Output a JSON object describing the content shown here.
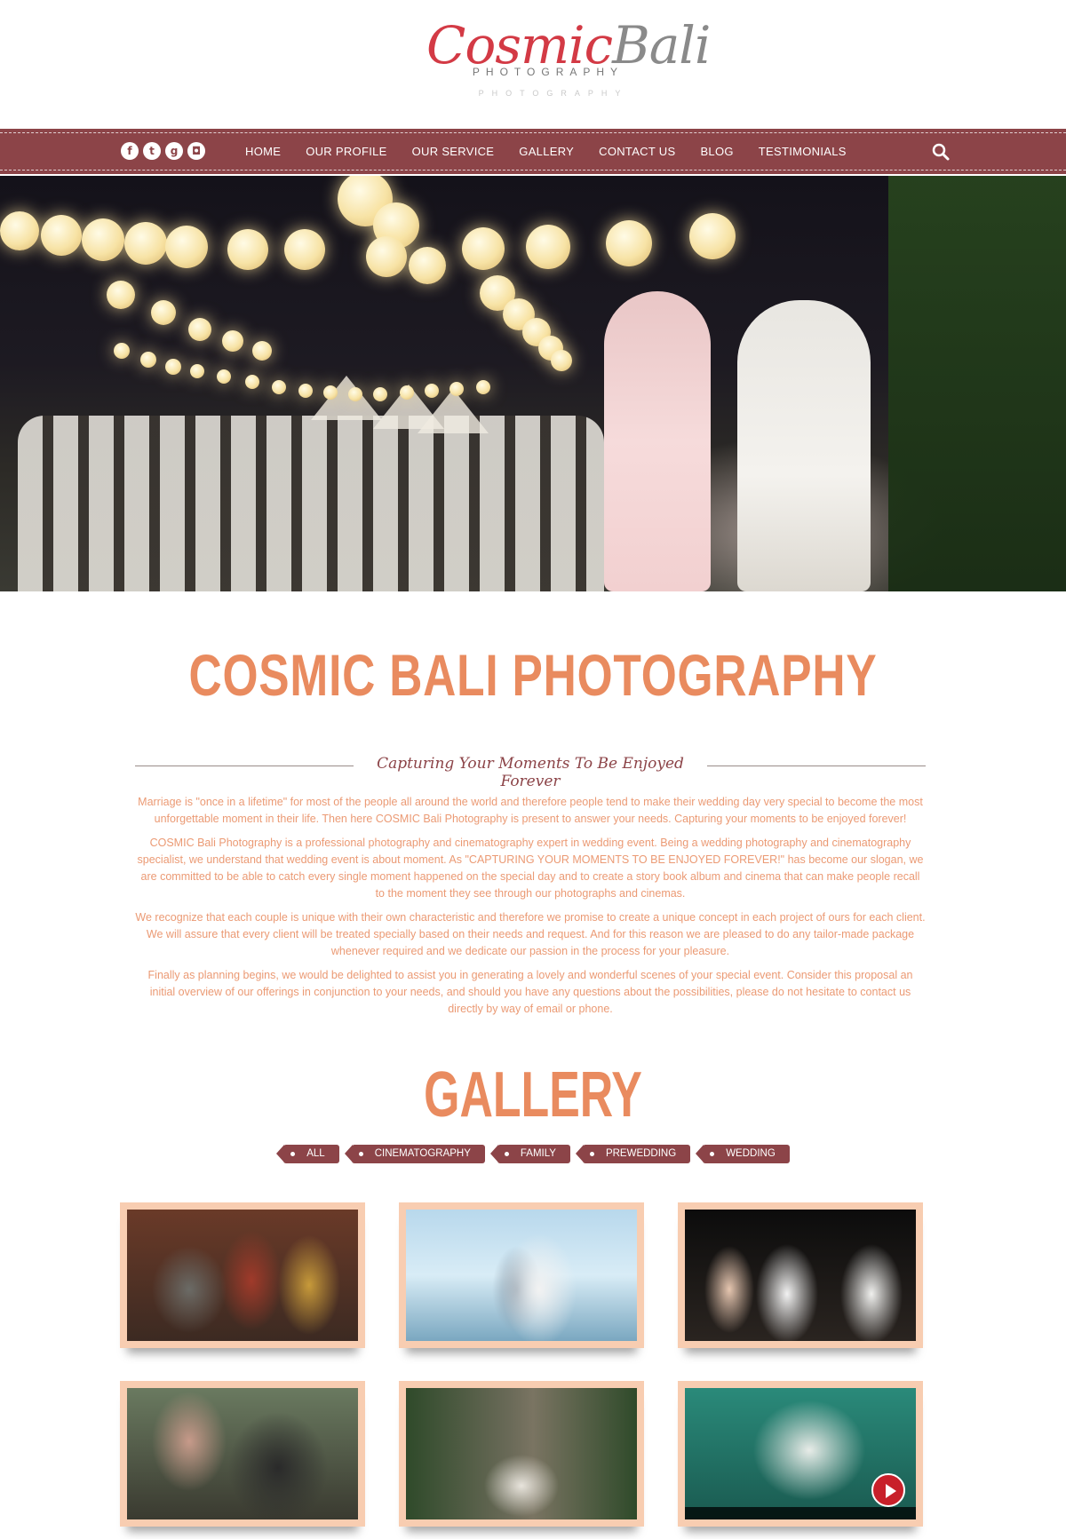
{
  "header": {
    "logo_cosmic": "Cosmic",
    "logo_bali": "Bali",
    "logo_sub": "PHOTOGRAPHY",
    "logo_sub_faded": "PHOTOGRAPHY"
  },
  "social": [
    {
      "icon": "facebook-icon",
      "glyph": "f"
    },
    {
      "icon": "twitter-icon",
      "glyph": "t"
    },
    {
      "icon": "google-plus-icon",
      "glyph": "g"
    },
    {
      "icon": "instagram-icon",
      "glyph": "◘"
    }
  ],
  "nav": {
    "items": [
      {
        "label": "HOME"
      },
      {
        "label": "OUR PROFILE"
      },
      {
        "label": "OUR SERVICE"
      },
      {
        "label": "GALLERY"
      },
      {
        "label": "CONTACT US"
      },
      {
        "label": "BLOG"
      },
      {
        "label": "TESTIMONIALS"
      }
    ]
  },
  "intro": {
    "title": "COSMIC BALI PHOTOGRAPHY",
    "tagline": "Capturing Your Moments To Be Enjoyed Forever",
    "paragraphs": [
      "Marriage is \"once in a lifetime\" for most of the people all around the world and therefore people tend to make their wedding day very special to become the most unforgettable moment in their life. Then here COSMIC Bali Photography is present to answer your needs. Capturing your moments to be enjoyed forever!",
      "COSMIC Bali Photography is a professional photography and cinematography expert in wedding event. Being a wedding photography and cinematography specialist, we understand that wedding event is about moment. As \"CAPTURING YOUR MOMENTS TO BE ENJOYED FOREVER!\" has become our slogan, we are committed to be able to catch every single moment happened on the special day and to create a story book album and cinema that can make people recall to the moment they see through our photographs and cinemas.",
      "We recognize that each couple is unique with their own characteristic and therefore we promise to create a unique concept in each project of ours for each client. We will assure that every client will be treated specially based on their needs and request. And for this reason we are pleased to do any tailor-made package whenever required and we dedicate our passion in the process for your pleasure.",
      "Finally as planning begins, we would be delighted to assist you in generating a lovely and wonderful scenes of your special event. Consider this proposal an initial overview of our offerings in conjunction to your needs, and should you have any questions about the possibilities, please do not hesitate to contact us directly by way of email or phone."
    ]
  },
  "gallery": {
    "title": "GALLERY",
    "filters": [
      {
        "label": "ALL"
      },
      {
        "label": "CINEMATOGRAPHY"
      },
      {
        "label": "FAMILY"
      },
      {
        "label": "PREWEDDING"
      },
      {
        "label": "WEDDING"
      }
    ]
  },
  "colors": {
    "brand": "#8c4448",
    "accent": "#e98b5f",
    "logo_red": "#d33a45",
    "thumb_frame": "#f8cdb1"
  }
}
